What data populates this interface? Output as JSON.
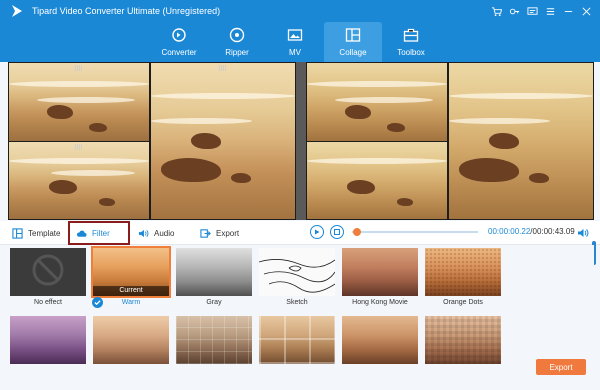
{
  "window": {
    "title": "Tipard Video Converter Ultimate (Unregistered)",
    "controls": [
      "cart-icon",
      "key-icon",
      "chat-icon",
      "menu-icon",
      "minimize-icon",
      "close-icon"
    ]
  },
  "nav": {
    "items": [
      {
        "label": "Converter",
        "icon": "converter-icon",
        "active": false
      },
      {
        "label": "Ripper",
        "icon": "ripper-icon",
        "active": false
      },
      {
        "label": "MV",
        "icon": "mv-icon",
        "active": false
      },
      {
        "label": "Collage",
        "icon": "collage-icon",
        "active": true
      },
      {
        "label": "Toolbox",
        "icon": "toolbox-icon",
        "active": false
      }
    ]
  },
  "tabs": {
    "template": "Template",
    "filter": "Filter",
    "audio": "Audio",
    "export": "Export"
  },
  "player": {
    "current_time": "00:00:00.22",
    "total_time": "/00:00:43.09",
    "progress": 0.01
  },
  "filters": {
    "row1": [
      {
        "name": "No effect",
        "style": "none"
      },
      {
        "name": "Warm",
        "style": "warm",
        "selected": true,
        "badge": "Current"
      },
      {
        "name": "Gray",
        "style": "gray"
      },
      {
        "name": "Sketch",
        "style": "sketch"
      },
      {
        "name": "Hong Kong Movie",
        "style": "hk"
      },
      {
        "name": "Orange Dots",
        "style": "dots"
      }
    ]
  },
  "export_button": "Export",
  "colors": {
    "header": "#1b88d6",
    "accent": "#1b88d6",
    "export": "#f07a3e",
    "selection": "#f07f3c"
  }
}
